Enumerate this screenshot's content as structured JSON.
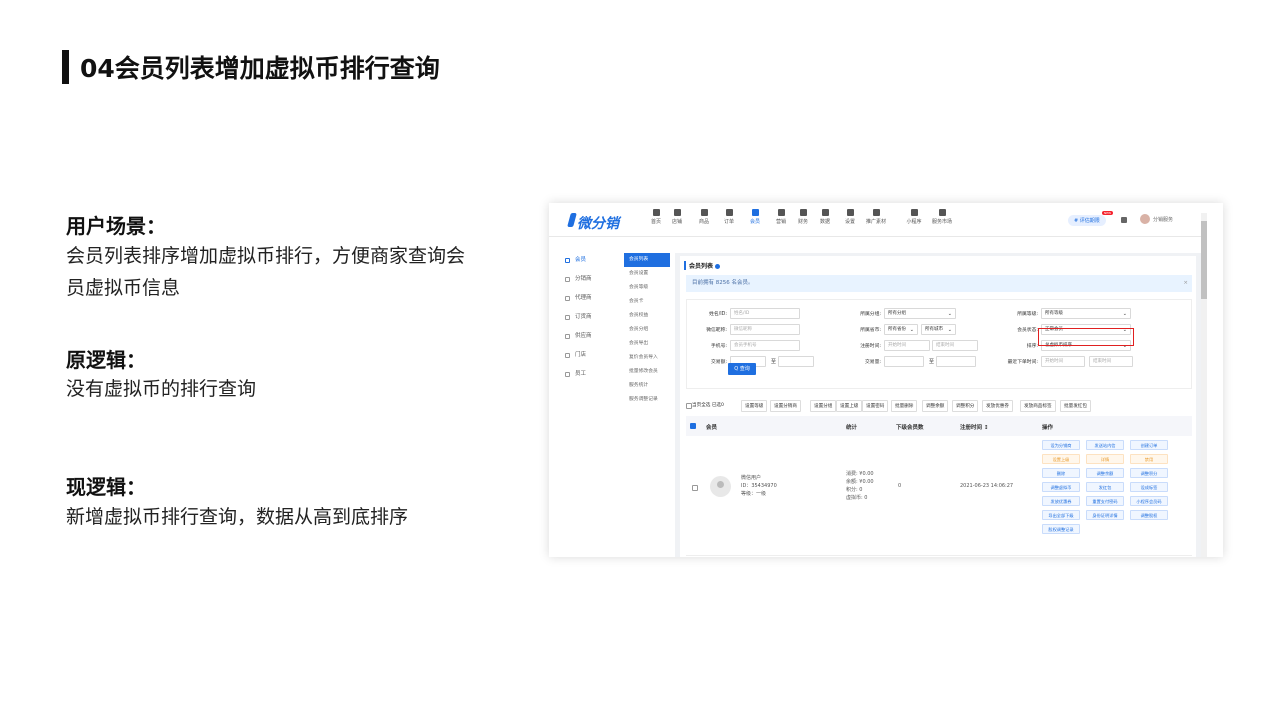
{
  "slide": {
    "title": "04会员列表增加虚拟币排行查询",
    "scene_heading": "用户场景：",
    "scene_text": "会员列表排序增加虚拟币排行，方便商家查询会员虚拟币信息",
    "old_heading": "原逻辑：",
    "old_text": "没有虚拟币的排行查询",
    "new_heading": "现逻辑：",
    "new_text": "新增虚拟币排行查询，数据从高到底排序"
  },
  "app": {
    "logo": "微分销",
    "nav": [
      "首页",
      "店铺",
      "商品",
      "订单",
      "会员",
      "营销",
      "财务",
      "数据",
      "设置",
      "推广素材",
      "小程序",
      "服务市场"
    ],
    "active_nav": "会员",
    "trial": "# 评估期限",
    "new_badge": "NEW",
    "user": "分销服务"
  },
  "sidebar": {
    "items": [
      "会员",
      "分销商",
      "代理商",
      "订货商",
      "供应商",
      "门店",
      "员工"
    ],
    "sub_items": [
      "会员列表",
      "会员设置",
      "会员等级",
      "会员卡",
      "会员权益",
      "会员分组",
      "会员导出",
      "复价会员导入",
      "批量修改会员",
      "服务统计",
      "服务调整记录"
    ]
  },
  "content": {
    "title": "会员列表",
    "notice": "目前拥有 8256 名会员。",
    "notice_close": "×",
    "filters": {
      "name_label": "姓名/ID:",
      "name_ph": "姓名/ID",
      "nick_label": "微信昵称:",
      "nick_ph": "微信昵称",
      "phone_label": "手机号:",
      "phone_ph": "会员手机号",
      "trade_label": "交易额:",
      "to": "至",
      "group_label": "所属分组:",
      "group_val": "所有分组",
      "province_label": "所属省市:",
      "province_val": "所有省份",
      "city_val": "所有城市",
      "regtime_label": "注册时间:",
      "start_ph": "开始时间",
      "end_ph": "结束时间",
      "tradecount_label": "交易量:",
      "level_label": "所属等级:",
      "level_val": "所有等级",
      "status_label": "会员状态:",
      "status_val": "正常会员",
      "sort_label": "排序:",
      "sort_val": "总虚拟币排序",
      "lastorder_label": "最近下单时间:",
      "search_btn": "Q 查询"
    },
    "actions": [
      "当页全选 已选0",
      "设置等级",
      "设置分销商",
      "设置分组",
      "设置上级",
      "设置密码",
      "批量删除",
      "调整余额",
      "调整积分",
      "发放优惠券",
      "发放商品标签",
      "批量发红包"
    ],
    "table_headers": [
      "会员",
      "统计",
      "下级会员数",
      "注册时间 ↕",
      "操作"
    ],
    "row": {
      "name": "微信用户",
      "id": "ID：35434970",
      "level": "等级：一级",
      "stats": [
        "消费: ¥0.00",
        "余额: ¥0.00",
        "积分: 0",
        "虚拟币: 0"
      ],
      "sub_count": "0",
      "reg_time": "2021-06-23 14:06:27",
      "ops": [
        [
          "设为分销商",
          "发送站内信",
          "创建订单"
        ],
        [
          "设置上级",
          "详情",
          "禁用"
        ],
        [
          "删除",
          "调整余额",
          "调整积分"
        ],
        [
          "调整虚拟币",
          "发红包",
          "设成标签"
        ],
        [
          "发放优惠券",
          "重置支付密码",
          "小程序会员码"
        ],
        [
          "导出全部下级",
          "身份证明详情",
          "调整股权"
        ],
        [
          "股权调整记录"
        ]
      ]
    }
  }
}
